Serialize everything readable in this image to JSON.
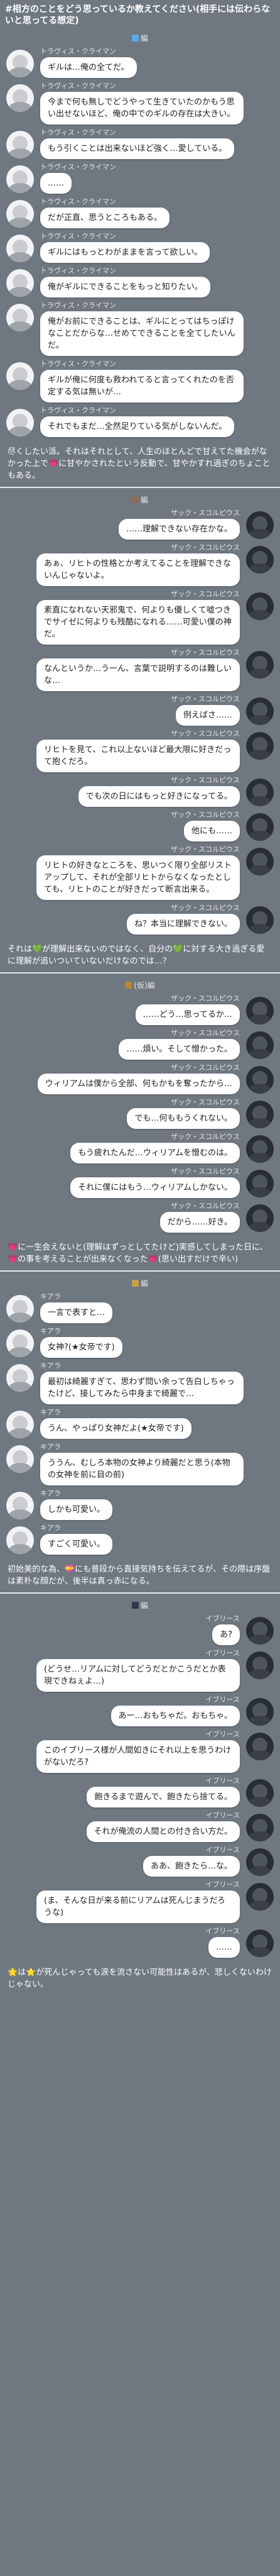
{
  "header": {
    "title": "#相方のことをどう思っているか教えてください(相手には伝わらないと思ってる想定)"
  },
  "sections": [
    {
      "title": "編",
      "title_color": "#5aa9e6",
      "messages": [
        {
          "side": "left",
          "name": "トラヴィス・クライマン",
          "text": "ギルは…俺の全てだ。"
        },
        {
          "side": "left",
          "name": "トラヴィス・クライマン",
          "text": "今まで何も無しでどうやって生きていたのかもう思い出せないほど、俺の中でのギルの存在は大きい。"
        },
        {
          "side": "left",
          "name": "トラヴィス・クライマン",
          "text": "もう引くことは出来ないほど強く…愛している。"
        },
        {
          "side": "left",
          "name": "トラヴィス・クライマン",
          "text": "……"
        },
        {
          "side": "left",
          "name": "トラヴィス・クライマン",
          "text": "だが正直、思うところもある。"
        },
        {
          "side": "left",
          "name": "トラヴィス・クライマン",
          "text": "ギルにはもっとわがままを言って欲しい。"
        },
        {
          "side": "left",
          "name": "トラヴィス・クライマン",
          "text": "俺がギルにできることをもっと知りたい。"
        },
        {
          "side": "left",
          "name": "トラヴィス・クライマン",
          "text": "俺がお前にできることは、ギルにとってはちっぽけなことだからな…せめてできることを全てしたいんだ。"
        },
        {
          "side": "left",
          "name": "トラヴィス・クライマン",
          "text": "ギルが俺に何度も救われてると言ってくれたのを否定する気は無いが…"
        },
        {
          "side": "left",
          "name": "トラヴィス・クライマン",
          "text": "それでもまだ…全然足りている気がしないんだ。"
        }
      ],
      "narration": "尽くしたい派。それはそれとして、人生のほとんどで甘えてた機会がなかった上で💗に甘やかされたという反動で、甘やかすれ過ぎのちょこともある。"
    },
    {
      "title": "編",
      "title_color": "#8a6f55",
      "messages": [
        {
          "side": "right",
          "name": "ザック・スコルピウス",
          "text": "……理解できない存在かな。"
        },
        {
          "side": "right",
          "name": "ザック・スコルピウス",
          "text": "あぁ、リヒトの性格とか考えてることを理解できないんじゃないよ。"
        },
        {
          "side": "right",
          "name": "ザック・スコルピウス",
          "text": "素直になれない天邪鬼で、何よりも優しくて嘘つきでサイゼに何よりも残酷になれる……可愛い僕の神だ。"
        },
        {
          "side": "right",
          "name": "ザック・スコルピウス",
          "text": "なんというか…うーん、言葉で説明するのは難しいな…"
        },
        {
          "side": "right",
          "name": "ザック・スコルピウス",
          "text": "例えばさ……"
        },
        {
          "side": "right",
          "name": "ザック・スコルピウス",
          "text": "リヒトを見て、これ以上ないほど最大限に好きだって抱くだろ。"
        },
        {
          "side": "right",
          "name": "ザック・スコルピウス",
          "text": "でも次の日にはもっと好きになってる。"
        },
        {
          "side": "right",
          "name": "ザック・スコルピウス",
          "text": "他にも……"
        },
        {
          "side": "right",
          "name": "ザック・スコルピウス",
          "text": "リヒトの好きなところを、思いつく限り全部リストアップして、それが全部リヒトからなくなったとしても、リヒトのことが好きだって断言出来る。"
        },
        {
          "side": "right",
          "name": "ザック・スコルピウス",
          "text": "ね？本当に理解できない。"
        }
      ],
      "narration": "それは💚が理解出来ないのではなく、自分の💚に対する大き過ぎる愛に理解が追いついていないだけなのでは…？"
    },
    {
      "title": "(仮)編",
      "title_color": "#b8862e",
      "messages": [
        {
          "side": "right",
          "name": "ザック・スコルピウス",
          "text": "……どう…思ってるか…"
        },
        {
          "side": "right",
          "name": "ザック・スコルピウス",
          "text": "……煩い。そして憎かった。"
        },
        {
          "side": "right",
          "name": "ザック・スコルピウス",
          "text": "ウィリアムは僕から全部、何もかもを奪ったから…"
        },
        {
          "side": "right",
          "name": "ザック・スコルピウス",
          "text": "でも…何ももうくれない。"
        },
        {
          "side": "right",
          "name": "ザック・スコルピウス",
          "text": "もう疲れたんだ…ウィリアムを憎むのは。"
        },
        {
          "side": "right",
          "name": "ザック・スコルピウス",
          "text": "それに僕にはもう…ウィリアムしかない。"
        },
        {
          "side": "right",
          "name": "ザック・スコルピウス",
          "text": "だから……好き。"
        }
      ],
      "narration": "💗に一生会えないと(理解はずっとしてたけど)実感してしまった日に、💗の事を考えることが出来なくなった💗(思い出すだけで辛い)"
    },
    {
      "title": "編",
      "title_color": "#c7a04a",
      "messages": [
        {
          "side": "left",
          "name": "キアラ",
          "text": "一言で表すと…"
        },
        {
          "side": "left",
          "name": "キアラ",
          "text": "女神?(★女帝です)"
        },
        {
          "side": "left",
          "name": "キアラ",
          "text": "最初は綺麗すぎて、思わず問い余って告白しちゃったけど、接してみたら中身まで綺麗で…"
        },
        {
          "side": "left",
          "name": "キアラ",
          "text": "うん、やっぱり女神だよ(★女帝です)"
        },
        {
          "side": "left",
          "name": "キアラ",
          "text": "ううん、むしろ本物の女神より綺麗だと思う(本物の女神を前に目の前)"
        },
        {
          "side": "left",
          "name": "キアラ",
          "text": "しかも可愛い。"
        },
        {
          "side": "left",
          "name": "キアラ",
          "text": "すごく可愛い。"
        }
      ],
      "narration": "初始美的な為、💝にも普段から直接気持ちを伝えてるが、その際は序盤は素朴な顔だが、後半は真っ赤になる。"
    },
    {
      "title": "編",
      "title_color": "#2d3a4c",
      "messages": [
        {
          "side": "right",
          "name": "イブリース",
          "text": "あ?"
        },
        {
          "side": "right",
          "name": "イブリース",
          "text": "(どうせ…リアムに対してどうだとかこうだとか表現できねぇよ…)"
        },
        {
          "side": "right",
          "name": "イブリース",
          "text": "あー…おもちゃだ。おもちゃ。"
        },
        {
          "side": "right",
          "name": "イブリース",
          "text": "このイブリース様が人間如きにそれ以上を思うわけがないだろ?"
        },
        {
          "side": "right",
          "name": "イブリース",
          "text": "飽きるまで遊んで、飽きたら捨てる。"
        },
        {
          "side": "right",
          "name": "イブリース",
          "text": "それが俺流の人間との付き合い方だ。"
        },
        {
          "side": "right",
          "name": "イブリース",
          "text": "ああ、飽きたら…な。"
        },
        {
          "side": "right",
          "name": "イブリース",
          "text": "(ま、そんな日が来る前にリアムは死んじまうだろうな)"
        },
        {
          "side": "right",
          "name": "イブリース",
          "text": "……"
        }
      ],
      "narration": "🌟は⭐が死んじゃっても涙を流さない可能性はあるが、悲しくないわけじゃない。"
    }
  ]
}
